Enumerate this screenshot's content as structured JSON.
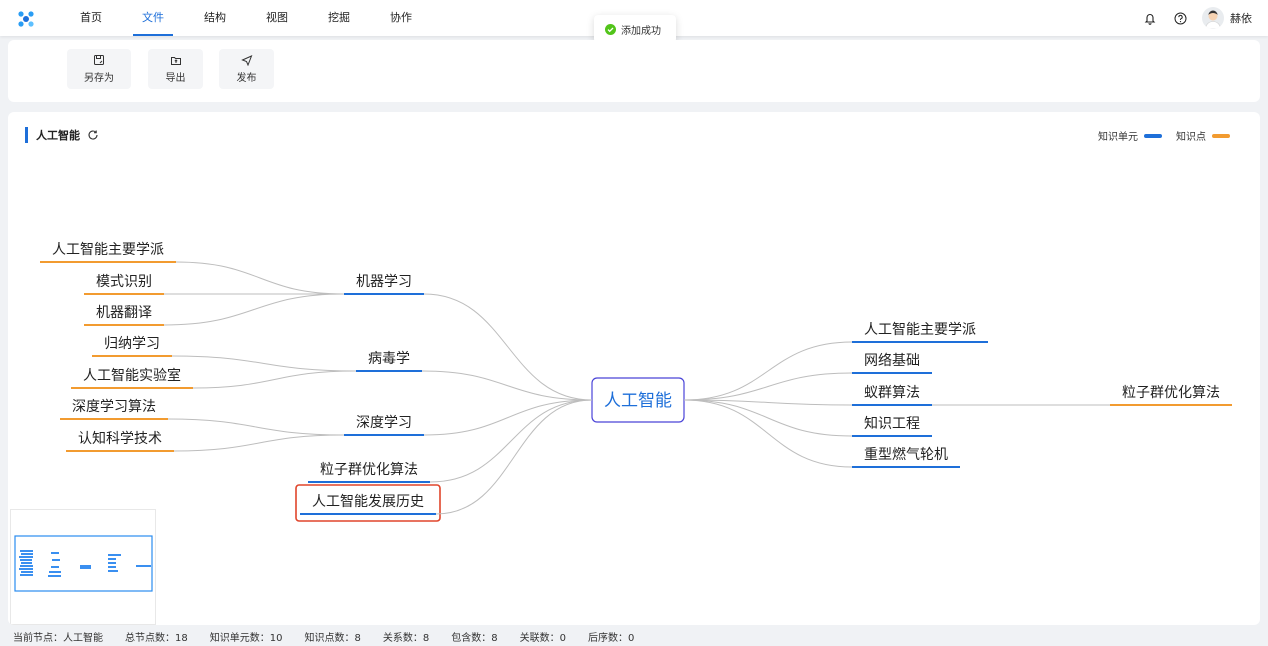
{
  "nav": {
    "items": [
      {
        "label": "首页",
        "active": false
      },
      {
        "label": "文件",
        "active": true
      },
      {
        "label": "结构",
        "active": false
      },
      {
        "label": "视图",
        "active": false
      },
      {
        "label": "挖掘",
        "active": false
      },
      {
        "label": "协作",
        "active": false
      }
    ]
  },
  "user": {
    "name": "赫依"
  },
  "toast": {
    "text": "添加成功"
  },
  "toolbar": {
    "save_as": "另存为",
    "export": "导出",
    "publish": "发布"
  },
  "map": {
    "title": "人工智能",
    "legend": [
      {
        "label": "知识单元",
        "color": "#1e6fd9"
      },
      {
        "label": "知识点",
        "color": "#f29b30"
      }
    ],
    "root": "人工智能",
    "left_branches": [
      {
        "label": "机器学习",
        "type": "unit",
        "children": [
          {
            "label": "人工智能主要学派",
            "type": "point"
          },
          {
            "label": "模式识别",
            "type": "point"
          },
          {
            "label": "机器翻译",
            "type": "point"
          }
        ]
      },
      {
        "label": "病毒学",
        "type": "unit",
        "children": [
          {
            "label": "归纳学习",
            "type": "point"
          },
          {
            "label": "人工智能实验室",
            "type": "point"
          }
        ]
      },
      {
        "label": "深度学习",
        "type": "unit",
        "children": [
          {
            "label": "深度学习算法",
            "type": "point"
          },
          {
            "label": "认知科学技术",
            "type": "point"
          }
        ]
      },
      {
        "label": "粒子群优化算法",
        "type": "unit",
        "children": []
      },
      {
        "label": "人工智能发展历史",
        "type": "unit",
        "selected": true,
        "children": []
      }
    ],
    "right_branches": [
      {
        "label": "人工智能主要学派",
        "type": "unit",
        "children": []
      },
      {
        "label": "网络基础",
        "type": "unit",
        "children": []
      },
      {
        "label": "蚁群算法",
        "type": "unit",
        "children": [
          {
            "label": "粒子群优化算法",
            "type": "point"
          }
        ]
      },
      {
        "label": "知识工程",
        "type": "unit",
        "children": []
      },
      {
        "label": "重型燃气轮机",
        "type": "unit",
        "children": []
      }
    ]
  },
  "status": {
    "current_node": "当前节点：人工智能",
    "total_nodes": "总节点数：18",
    "unit_count": "知识单元数：10",
    "point_count": "知识点数：8",
    "relation_count": "关系数：8",
    "contain_count": "包含数：8",
    "link_count": "关联数：0",
    "sequence_count": "后序数：0"
  },
  "colors": {
    "unit": "#1e6fd9",
    "point": "#f29b30",
    "selected_border": "#e0452b",
    "root_border": "#4a44d8",
    "root_text": "#1e6fd9",
    "link": "#bdbdbd"
  }
}
